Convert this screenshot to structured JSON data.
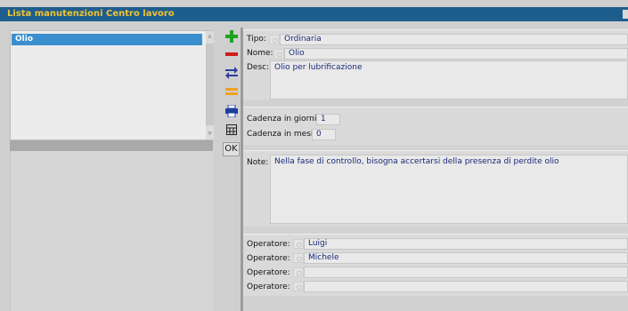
{
  "window": {
    "title": "Lista manutenzioni Centro lavoro"
  },
  "list": {
    "items": [
      {
        "label": "Olio",
        "selected": true
      }
    ]
  },
  "toolbar": {
    "buttons": [
      {
        "icon": "plus-icon",
        "color": "#1fa31f"
      },
      {
        "icon": "minus-icon",
        "color": "#d01c1c"
      },
      {
        "icon": "swap-arrows-icon",
        "color": "#2c3f9c"
      },
      {
        "icon": "equals-icon",
        "color": "#f0a020"
      },
      {
        "icon": "printer-icon",
        "color": "#1e3fa0"
      },
      {
        "icon": "table-icon",
        "color": "#222222"
      }
    ],
    "ok_label": "OK"
  },
  "details": {
    "tipo": {
      "label": "Tipo:",
      "value": "Ordinaria"
    },
    "nome": {
      "label": "Nome:",
      "value": "Olio"
    },
    "desc": {
      "label": "Desc:",
      "value": "Olio per lubrificazione"
    },
    "cadenza_giorni": {
      "label": "Cadenza in giorni:",
      "value": "1"
    },
    "cadenza_mesi": {
      "label": "Cadenza in mesi:",
      "value": "0"
    },
    "note": {
      "label": "Note:",
      "value": "Nella fase di controllo, bisogna accertarsi della presenza di perdite olio"
    },
    "operatori": [
      {
        "label": "Operatore:",
        "value": "Luigi"
      },
      {
        "label": "Operatore:",
        "value": "Michele"
      },
      {
        "label": "Operatore:",
        "value": ""
      },
      {
        "label": "Operatore:",
        "value": ""
      }
    ]
  }
}
